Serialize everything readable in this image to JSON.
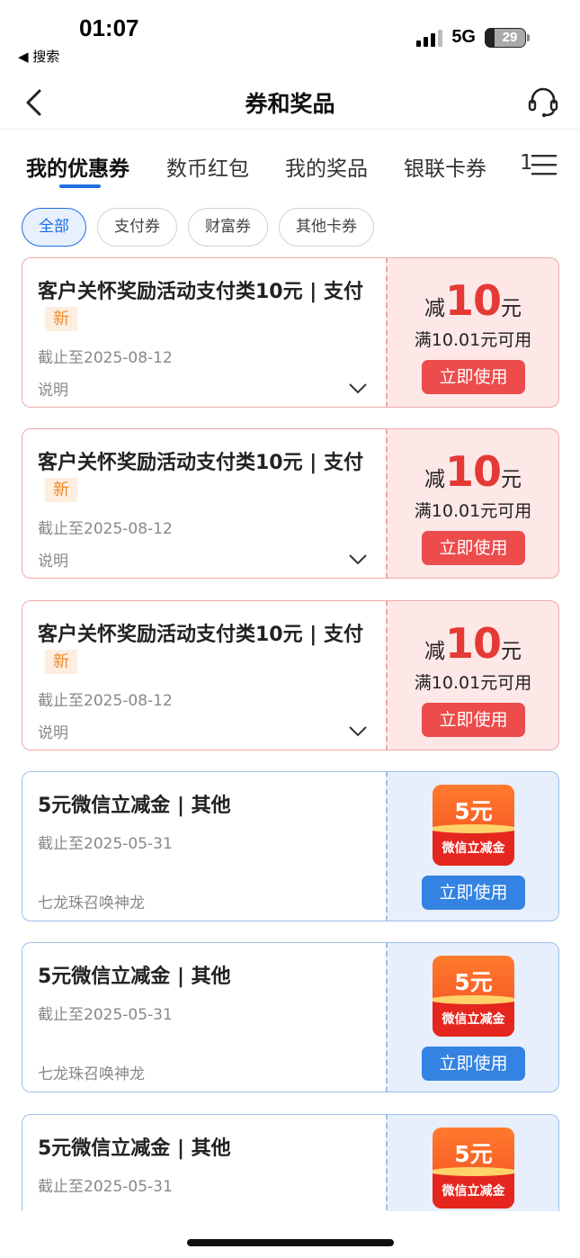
{
  "status": {
    "time": "01:07",
    "back_label": "◀ 搜索",
    "network": "5G",
    "battery": "29"
  },
  "nav": {
    "title": "券和奖品"
  },
  "tabs": [
    "我的优惠券",
    "数币红包",
    "我的奖品",
    "银联卡券",
    "1"
  ],
  "filters": [
    "全部",
    "支付券",
    "财富券",
    "其他卡券"
  ],
  "coupons": [
    {
      "type": "red",
      "title": "客户关怀奖励活动支付类10元 | 支付",
      "badge": "新",
      "expire": "截止至2025-08-12",
      "note": "说明",
      "prefix": "减",
      "amount": "10",
      "unit": "元",
      "condition": "满10.01元可用",
      "button": "立即使用"
    },
    {
      "type": "red",
      "title": "客户关怀奖励活动支付类10元 | 支付",
      "badge": "新",
      "expire": "截止至2025-08-12",
      "note": "说明",
      "prefix": "减",
      "amount": "10",
      "unit": "元",
      "condition": "满10.01元可用",
      "button": "立即使用"
    },
    {
      "type": "red",
      "title": "客户关怀奖励活动支付类10元 | 支付",
      "badge": "新",
      "expire": "截止至2025-08-12",
      "note": "说明",
      "prefix": "减",
      "amount": "10",
      "unit": "元",
      "condition": "满10.01元可用",
      "button": "立即使用"
    },
    {
      "type": "blue",
      "title": "5元微信立减金 | 其他",
      "expire": "截止至2025-05-31",
      "note": "七龙珠召唤神龙",
      "badge_amount": "5元",
      "badge_label": "微信立减金",
      "button": "立即使用"
    },
    {
      "type": "blue",
      "title": "5元微信立减金 | 其他",
      "expire": "截止至2025-05-31",
      "note": "七龙珠召唤神龙",
      "badge_amount": "5元",
      "badge_label": "微信立减金",
      "button": "立即使用"
    },
    {
      "type": "blue",
      "title": "5元微信立减金 | 其他",
      "expire": "截止至2025-05-31",
      "badge_amount": "5元",
      "badge_label": "微信立减金"
    }
  ],
  "colors": {
    "accent": "#1e6fe0",
    "red": "#ec4c4c",
    "blue_button": "#3483e2"
  }
}
